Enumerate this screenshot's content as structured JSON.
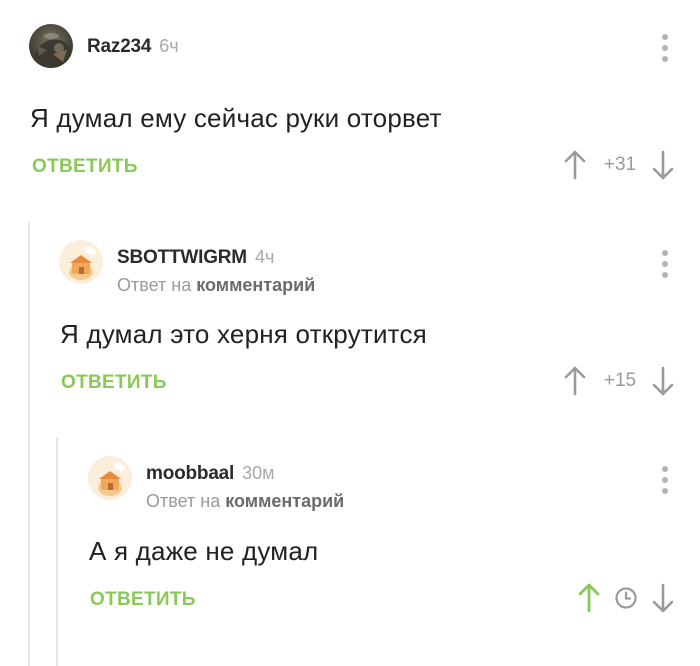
{
  "comments": [
    {
      "username": "Raz234",
      "time": "6ч",
      "text": "Я думал ему сейчас руки оторвет",
      "reply_label": "ОТВЕТИТЬ",
      "rating": "+31"
    },
    {
      "username": "SBOTTWIGRM",
      "time": "4ч",
      "reply_prefix": "Ответ на",
      "reply_target": "комментарий",
      "text": "Я думал это херня открутится",
      "reply_label": "ОТВЕТИТЬ",
      "rating": "+15"
    },
    {
      "username": "moobbaal",
      "time": "30м",
      "reply_prefix": "Ответ на",
      "reply_target": "комментарий",
      "text": "А я даже не думал",
      "reply_label": "ОТВЕТИТЬ"
    }
  ],
  "colors": {
    "accent": "#8ac858",
    "upvoted": "#8ac858",
    "muted": "#9a9a9a",
    "thread_line": "#e6e6e6"
  },
  "icons": {
    "upvote": "arrow-up-icon",
    "downvote": "arrow-down-icon",
    "pending_rating": "clock-icon",
    "menu": "more-vertical-icon"
  }
}
